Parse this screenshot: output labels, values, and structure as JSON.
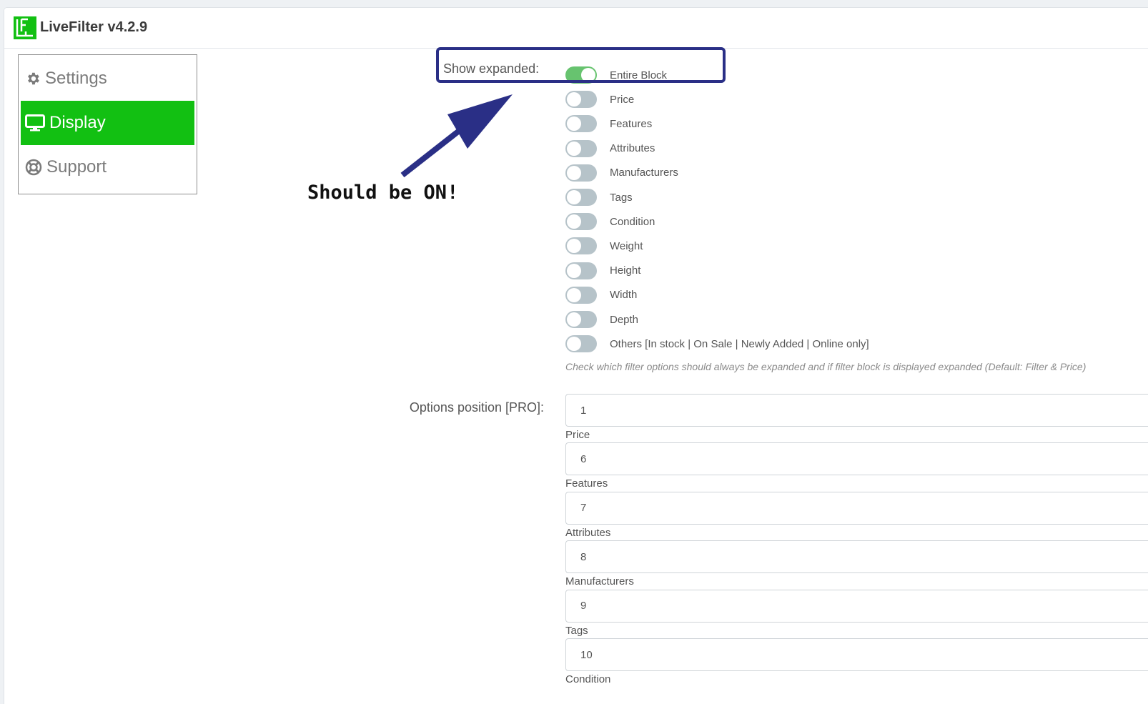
{
  "app": {
    "title": "LiveFilter v4.2.9"
  },
  "sidebar": {
    "items": [
      {
        "label": "Settings",
        "icon": "gear-icon",
        "active": false
      },
      {
        "label": "Display",
        "icon": "monitor-icon",
        "active": true
      },
      {
        "label": "Support",
        "icon": "lifebuoy-icon",
        "active": false
      }
    ]
  },
  "colors": {
    "accent": "#12c012",
    "toggle_on": "#67c36f",
    "toggle_off": "#b6c3c9",
    "annotation": "#2a2f86"
  },
  "show_expanded": {
    "label": "Show expanded:",
    "toggles": [
      {
        "label": "Entire Block",
        "on": true
      },
      {
        "label": "Price",
        "on": false
      },
      {
        "label": "Features",
        "on": false
      },
      {
        "label": "Attributes",
        "on": false
      },
      {
        "label": "Manufacturers",
        "on": false
      },
      {
        "label": "Tags",
        "on": false
      },
      {
        "label": "Condition",
        "on": false
      },
      {
        "label": "Weight",
        "on": false
      },
      {
        "label": "Height",
        "on": false
      },
      {
        "label": "Width",
        "on": false
      },
      {
        "label": "Depth",
        "on": false
      },
      {
        "label": "Others [In stock | On Sale | Newly Added | Online only]",
        "on": false
      }
    ],
    "help": "Check which filter options should always be expanded and if filter block is displayed expanded (Default: Filter & Price)"
  },
  "annotation": {
    "text": "Should be ON!"
  },
  "options_position": {
    "label": "Options position [PRO]:",
    "fields": [
      {
        "value": "1",
        "caption": "Price"
      },
      {
        "value": "6",
        "caption": "Features"
      },
      {
        "value": "7",
        "caption": "Attributes"
      },
      {
        "value": "8",
        "caption": "Manufacturers"
      },
      {
        "value": "9",
        "caption": "Tags"
      },
      {
        "value": "10",
        "caption": "Condition"
      }
    ]
  }
}
